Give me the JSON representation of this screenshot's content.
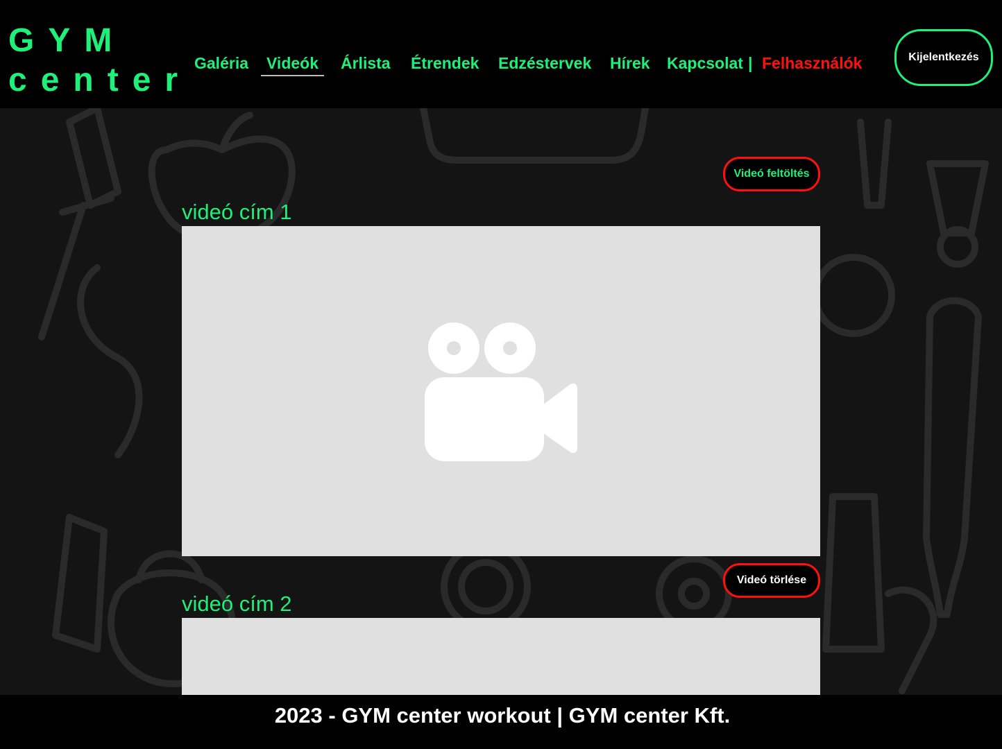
{
  "logo": {
    "line1": "GYM",
    "line2": "center"
  },
  "nav": {
    "items": [
      {
        "label": "Galéria"
      },
      {
        "label": "Videók"
      },
      {
        "label": "Árlista"
      },
      {
        "label": "Étrendek"
      },
      {
        "label": "Edzéstervek"
      },
      {
        "label": "Hírek"
      },
      {
        "label": "Kapcsolat"
      },
      {
        "label": "Felhasználók"
      }
    ],
    "separator": "|",
    "active": "Videók"
  },
  "logout_button": "Kijelentkezés",
  "upload_button": "Videó feltöltés",
  "videos": [
    {
      "title": "videó cím 1"
    },
    {
      "title": "videó cím 2"
    }
  ],
  "delete_button": "Videó törlése",
  "footer": "2023 - GYM center workout | GYM center Kft.",
  "colors": {
    "accent": "#1ef07a",
    "danger": "#ff1010",
    "background": "#141414",
    "video_placeholder": "#e0e0e0"
  },
  "icons": [
    "video-camera-icon"
  ]
}
